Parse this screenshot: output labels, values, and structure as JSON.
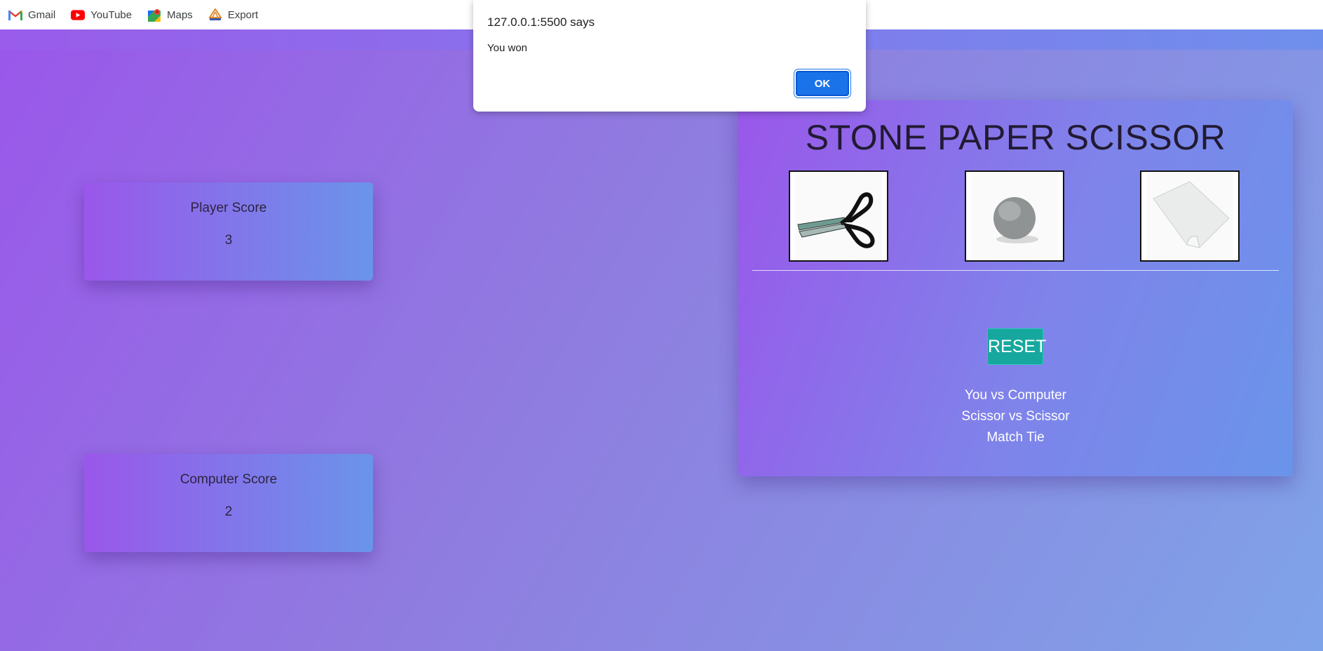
{
  "bookmarks": [
    {
      "label": "Gmail",
      "icon": "gmail-icon"
    },
    {
      "label": "YouTube",
      "icon": "youtube-icon"
    },
    {
      "label": "Maps",
      "icon": "maps-icon"
    },
    {
      "label": "Export",
      "icon": "export-icon"
    }
  ],
  "alert": {
    "title": "127.0.0.1:5500 says",
    "message": "You won",
    "ok_label": "OK"
  },
  "player_score": {
    "label": "Player Score",
    "value": "3"
  },
  "computer_score": {
    "label": "Computer Score",
    "value": "2"
  },
  "game": {
    "title": "STONE PAPER SCISSOR",
    "choices": [
      {
        "name": "scissor",
        "icon": "scissors-icon"
      },
      {
        "name": "stone",
        "icon": "stone-icon"
      },
      {
        "name": "paper",
        "icon": "paper-icon"
      }
    ],
    "reset_label": "RESET",
    "result_lines": [
      "You vs Computer",
      "Scissor vs Scissor",
      "Match Tie"
    ]
  },
  "colors": {
    "background_start": "#9a57ea",
    "background_end": "#7fa3e8",
    "reset_button": "#16a89e",
    "alert_button": "#1a73e8"
  }
}
